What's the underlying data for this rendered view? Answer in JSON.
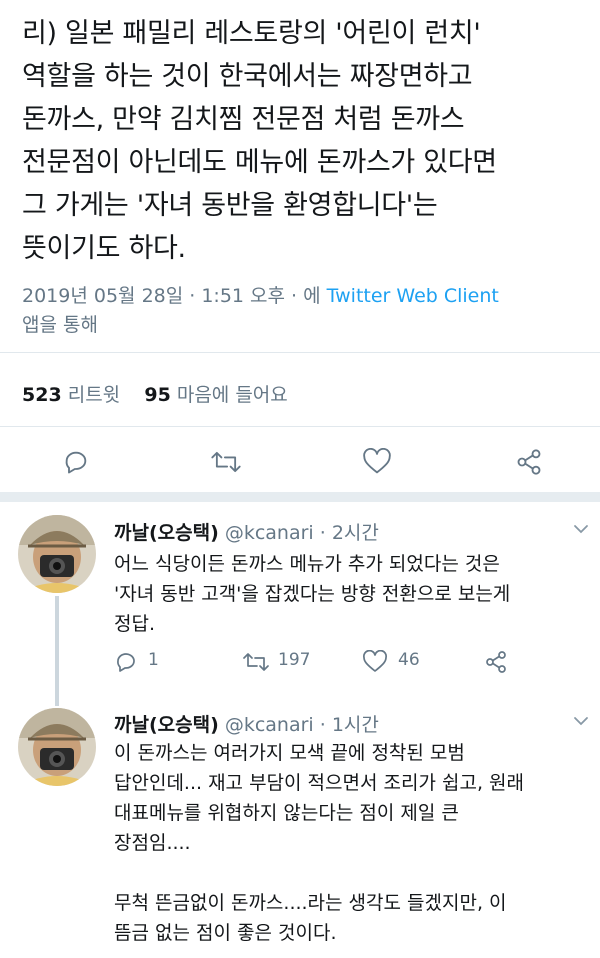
{
  "main_tweet": {
    "lines": [
      "리) 일본 패밀리 레스토랑의 '어린이 런치'",
      "역할을 하는 것이 한국에서는 짜장면하고",
      "돈까스, 만약 김치찜 전문점 처럼 돈까스",
      "전문점이 아닌데도 메뉴에 돈까스가 있다면",
      "그 가게는 '자녀 동반을 환영합니다'는",
      "뜻이기도 하다."
    ],
    "timestamp": "2019년 05월 28일 · 1:51 오후 · 에",
    "client": "Twitter Web Client",
    "via": "앱을 통해",
    "retweet_count": "523",
    "retweet_label": "리트윗",
    "like_count": "95",
    "like_label": "마음에 들어요"
  },
  "replies": [
    {
      "name": "까날(오승택)",
      "handle": "@kcanari · 2시간",
      "lines": [
        "어느 식당이든 돈까스 메뉴가 추가 되었다는 것은",
        "'자녀 동반 고객'을 잡겠다는 방향 전환으로 보는게",
        "정답."
      ],
      "reply_count": "1",
      "retweet_count": "197",
      "like_count": "46"
    },
    {
      "name": "까날(오승택)",
      "handle": "@kcanari · 1시간",
      "lines": [
        "이 돈까스는 여러가지 모색 끝에 정착된 모범",
        "답안인데... 재고 부담이 적으면서 조리가 쉽고, 원래",
        "대표메뉴를 위협하지 않는다는 점이 제일 큰",
        "장점임....",
        "",
        "무척 뜬금없이 돈까스....라는 생각도 들겠지만, 이",
        "뜸금 없는 점이 좋은 것이다."
      ]
    }
  ],
  "icons": [
    "reply-icon",
    "retweet-icon",
    "like-icon",
    "share-icon",
    "chevron-down-icon",
    "avatar"
  ],
  "colors": {
    "text": "#14171a",
    "muted": "#657786",
    "link": "#1da1f2",
    "divider": "#e1e8ed"
  }
}
